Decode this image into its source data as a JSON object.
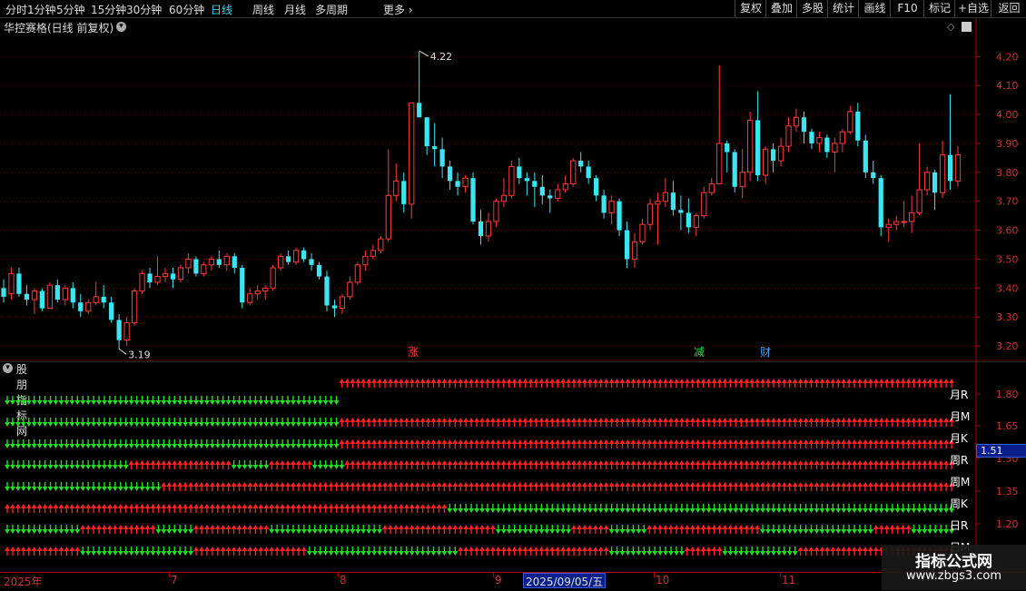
{
  "toolbar": {
    "timeframes": [
      "分时",
      "1分钟",
      "5分钟",
      "15分钟",
      "30分钟",
      "60分钟",
      "日线",
      "周线",
      "月线",
      "多周期",
      "更多"
    ],
    "active_timeframe": "日线",
    "more_icon": "chevron-right-icon",
    "right_buttons": [
      "复权",
      "叠加",
      "多股",
      "统计",
      "画线",
      "F10",
      "标记",
      "+自选",
      "返回"
    ]
  },
  "main": {
    "title": "华控赛格(日线 前复权)",
    "high_label": "4.22",
    "low_label": "3.19",
    "events": [
      "涨",
      "减",
      "财"
    ],
    "event_colors": [
      "#ff3a3a",
      "#22dd44",
      "#3aa0ff"
    ]
  },
  "indicator": {
    "name": "股朋指标网",
    "row_labels": [
      "月R",
      "月M",
      "月K",
      "周R",
      "周M",
      "周K",
      "日R",
      "日M"
    ],
    "cursor_value": "1.51",
    "y_ticks": [
      "1.80",
      "1.65",
      "1.50",
      "1.35",
      "1.20"
    ]
  },
  "axis": {
    "price_ticks": [
      "4.20",
      "4.10",
      "4.00",
      "3.90",
      "3.80",
      "3.70",
      "3.60",
      "3.50",
      "3.40",
      "3.30",
      "3.20"
    ],
    "x_labels": [
      "2025年",
      "7",
      "8",
      "9",
      "10",
      "11"
    ],
    "highlighted_date": "2025/09/05/五"
  },
  "watermark": {
    "title": "指标公式网",
    "url": "www.zbgs3.com"
  },
  "colors": {
    "up": "#ff3a3a",
    "down": "#3ce6f0",
    "arrow_up": "#ff2020",
    "arrow_down": "#22dd22",
    "axis": "#b00000",
    "active": "#37d3ea"
  },
  "chart_data": {
    "type": "candlestick",
    "title": "华控赛格(日线 前复权)",
    "ylim": [
      3.15,
      4.27
    ],
    "x_labels": [
      "2025年",
      "7",
      "8",
      "9",
      "10",
      "11"
    ],
    "ohlc": [
      [
        3.4,
        3.43,
        3.35,
        3.37
      ],
      [
        3.38,
        3.47,
        3.36,
        3.45
      ],
      [
        3.45,
        3.47,
        3.37,
        3.38
      ],
      [
        3.38,
        3.41,
        3.34,
        3.36
      ],
      [
        3.36,
        3.4,
        3.31,
        3.39
      ],
      [
        3.39,
        3.4,
        3.32,
        3.33
      ],
      [
        3.33,
        3.42,
        3.33,
        3.41
      ],
      [
        3.41,
        3.43,
        3.35,
        3.36
      ],
      [
        3.36,
        3.41,
        3.34,
        3.4
      ],
      [
        3.4,
        3.42,
        3.33,
        3.35
      ],
      [
        3.35,
        3.38,
        3.3,
        3.32
      ],
      [
        3.32,
        3.36,
        3.31,
        3.35
      ],
      [
        3.35,
        3.42,
        3.34,
        3.37
      ],
      [
        3.37,
        3.41,
        3.33,
        3.35
      ],
      [
        3.35,
        3.37,
        3.28,
        3.29
      ],
      [
        3.29,
        3.31,
        3.19,
        3.22
      ],
      [
        3.22,
        3.3,
        3.2,
        3.28
      ],
      [
        3.28,
        3.4,
        3.27,
        3.39
      ],
      [
        3.39,
        3.46,
        3.38,
        3.45
      ],
      [
        3.45,
        3.47,
        3.4,
        3.42
      ],
      [
        3.42,
        3.51,
        3.41,
        3.44
      ],
      [
        3.44,
        3.47,
        3.42,
        3.45
      ],
      [
        3.45,
        3.47,
        3.4,
        3.43
      ],
      [
        3.43,
        3.48,
        3.42,
        3.47
      ],
      [
        3.47,
        3.52,
        3.45,
        3.5
      ],
      [
        3.5,
        3.51,
        3.44,
        3.45
      ],
      [
        3.45,
        3.49,
        3.44,
        3.48
      ],
      [
        3.48,
        3.51,
        3.46,
        3.5
      ],
      [
        3.5,
        3.53,
        3.47,
        3.48
      ],
      [
        3.48,
        3.52,
        3.46,
        3.51
      ],
      [
        3.51,
        3.52,
        3.45,
        3.47
      ],
      [
        3.47,
        3.48,
        3.33,
        3.35
      ],
      [
        3.35,
        3.4,
        3.34,
        3.38
      ],
      [
        3.38,
        3.41,
        3.36,
        3.39
      ],
      [
        3.39,
        3.41,
        3.36,
        3.4
      ],
      [
        3.4,
        3.48,
        3.39,
        3.47
      ],
      [
        3.47,
        3.52,
        3.46,
        3.51
      ],
      [
        3.51,
        3.53,
        3.48,
        3.49
      ],
      [
        3.49,
        3.54,
        3.48,
        3.53
      ],
      [
        3.53,
        3.54,
        3.49,
        3.5
      ],
      [
        3.5,
        3.52,
        3.46,
        3.48
      ],
      [
        3.48,
        3.49,
        3.43,
        3.44
      ],
      [
        3.44,
        3.46,
        3.32,
        3.34
      ],
      [
        3.34,
        3.36,
        3.3,
        3.33
      ],
      [
        3.33,
        3.38,
        3.31,
        3.37
      ],
      [
        3.37,
        3.44,
        3.36,
        3.42
      ],
      [
        3.42,
        3.49,
        3.41,
        3.48
      ],
      [
        3.48,
        3.53,
        3.46,
        3.51
      ],
      [
        3.51,
        3.55,
        3.5,
        3.53
      ],
      [
        3.53,
        3.58,
        3.52,
        3.57
      ],
      [
        3.57,
        3.88,
        3.56,
        3.72
      ],
      [
        3.72,
        3.83,
        3.7,
        3.77
      ],
      [
        3.77,
        3.8,
        3.66,
        3.69
      ],
      [
        3.69,
        3.94,
        3.64,
        4.04
      ],
      [
        4.04,
        4.22,
        3.99,
        3.99
      ],
      [
        3.99,
        3.92,
        3.86,
        3.89
      ],
      [
        3.89,
        3.97,
        3.82,
        3.88
      ],
      [
        3.88,
        3.92,
        3.78,
        3.82
      ],
      [
        3.82,
        3.84,
        3.74,
        3.77
      ],
      [
        3.77,
        3.8,
        3.72,
        3.75
      ],
      [
        3.75,
        3.79,
        3.73,
        3.78
      ],
      [
        3.78,
        3.8,
        3.62,
        3.63
      ],
      [
        3.63,
        3.67,
        3.55,
        3.58
      ],
      [
        3.58,
        3.66,
        3.56,
        3.63
      ],
      [
        3.63,
        3.71,
        3.61,
        3.7
      ],
      [
        3.7,
        3.78,
        3.68,
        3.72
      ],
      [
        3.72,
        3.84,
        3.71,
        3.82
      ],
      [
        3.82,
        3.85,
        3.76,
        3.78
      ],
      [
        3.78,
        3.8,
        3.72,
        3.77
      ],
      [
        3.77,
        3.8,
        3.68,
        3.75
      ],
      [
        3.75,
        3.79,
        3.69,
        3.72
      ],
      [
        3.72,
        3.74,
        3.66,
        3.71
      ],
      [
        3.71,
        3.76,
        3.7,
        3.74
      ],
      [
        3.74,
        3.79,
        3.73,
        3.76
      ],
      [
        3.76,
        3.85,
        3.75,
        3.84
      ],
      [
        3.84,
        3.87,
        3.8,
        3.82
      ],
      [
        3.82,
        3.84,
        3.76,
        3.78
      ],
      [
        3.78,
        3.79,
        3.7,
        3.72
      ],
      [
        3.72,
        3.74,
        3.64,
        3.66
      ],
      [
        3.66,
        3.72,
        3.62,
        3.7
      ],
      [
        3.7,
        3.71,
        3.58,
        3.6
      ],
      [
        3.6,
        3.63,
        3.47,
        3.5
      ],
      [
        3.5,
        3.59,
        3.47,
        3.56
      ],
      [
        3.56,
        3.64,
        3.55,
        3.62
      ],
      [
        3.62,
        3.71,
        3.6,
        3.69
      ],
      [
        3.69,
        3.73,
        3.55,
        3.7
      ],
      [
        3.7,
        3.78,
        3.68,
        3.73
      ],
      [
        3.73,
        3.77,
        3.65,
        3.67
      ],
      [
        3.67,
        3.72,
        3.6,
        3.66
      ],
      [
        3.66,
        3.71,
        3.59,
        3.61
      ],
      [
        3.61,
        3.66,
        3.58,
        3.65
      ],
      [
        3.65,
        3.75,
        3.64,
        3.73
      ],
      [
        3.73,
        3.78,
        3.72,
        3.76
      ],
      [
        3.76,
        4.17,
        3.82,
        3.9
      ],
      [
        3.9,
        3.91,
        3.8,
        3.87
      ],
      [
        3.87,
        3.88,
        3.73,
        3.75
      ],
      [
        3.75,
        3.88,
        3.71,
        3.8
      ],
      [
        3.8,
        4.01,
        3.77,
        3.98
      ],
      [
        3.98,
        4.08,
        3.77,
        3.79
      ],
      [
        3.79,
        3.89,
        3.76,
        3.88
      ],
      [
        3.88,
        3.9,
        3.8,
        3.84
      ],
      [
        3.84,
        3.92,
        3.82,
        3.89
      ],
      [
        3.89,
        3.99,
        3.87,
        3.96
      ],
      [
        3.96,
        4.02,
        3.94,
        3.99
      ],
      [
        3.99,
        4.01,
        3.9,
        3.94
      ],
      [
        3.94,
        3.95,
        3.88,
        3.9
      ],
      [
        3.9,
        3.94,
        3.87,
        3.92
      ],
      [
        3.92,
        3.93,
        3.85,
        3.87
      ],
      [
        3.87,
        3.92,
        3.8,
        3.9
      ],
      [
        3.9,
        3.95,
        3.87,
        3.94
      ],
      [
        3.94,
        4.03,
        3.93,
        4.01
      ],
      [
        4.01,
        4.04,
        3.89,
        3.91
      ],
      [
        3.91,
        3.93,
        3.78,
        3.8
      ],
      [
        3.8,
        3.84,
        3.76,
        3.78
      ],
      [
        3.78,
        3.79,
        3.58,
        3.61
      ],
      [
        3.61,
        3.64,
        3.56,
        3.62
      ],
      [
        3.62,
        3.65,
        3.6,
        3.63
      ],
      [
        3.63,
        3.7,
        3.61,
        3.63
      ],
      [
        3.63,
        3.72,
        3.59,
        3.66
      ],
      [
        3.66,
        3.9,
        3.65,
        3.74
      ],
      [
        3.74,
        3.82,
        3.72,
        3.8
      ],
      [
        3.8,
        3.81,
        3.67,
        3.73
      ],
      [
        3.73,
        3.91,
        3.71,
        3.86
      ],
      [
        3.86,
        4.07,
        3.74,
        3.77
      ],
      [
        3.77,
        3.89,
        3.75,
        3.86
      ]
    ]
  }
}
